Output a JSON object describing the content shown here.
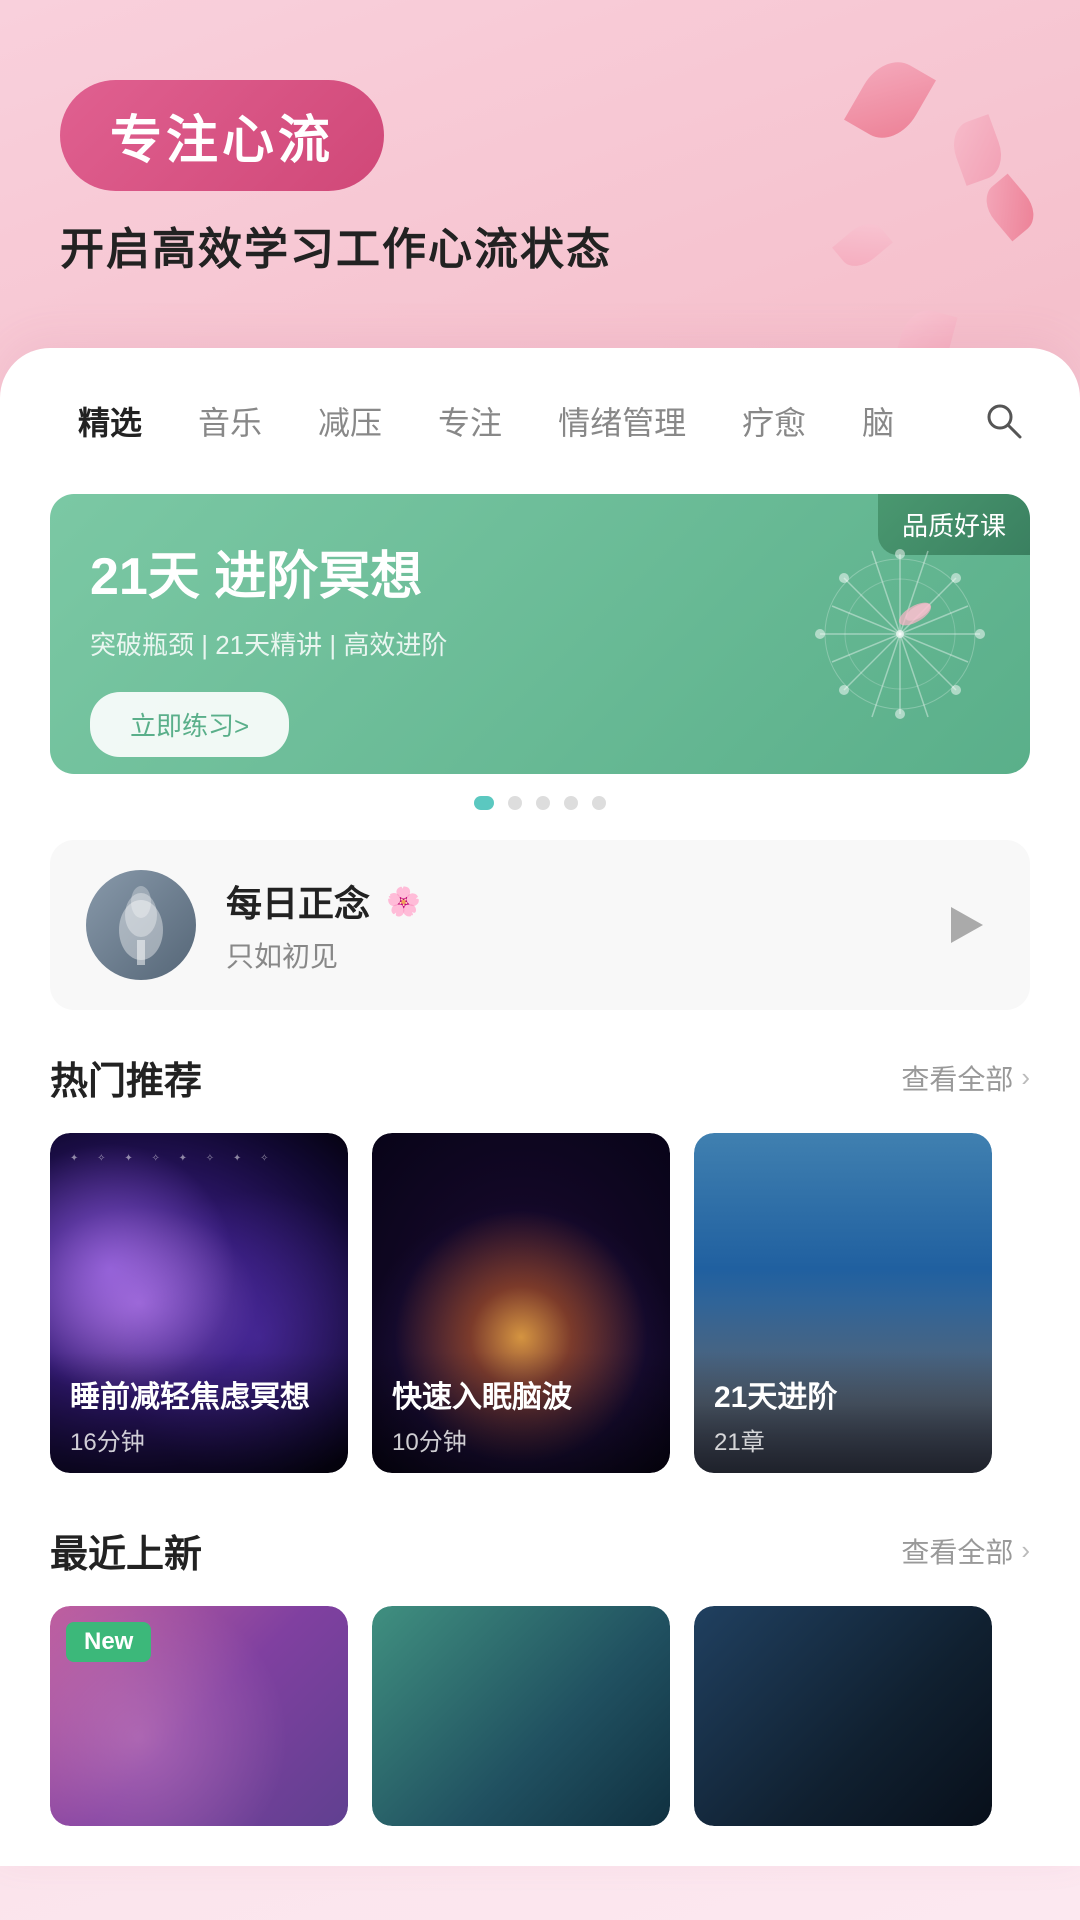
{
  "hero": {
    "badge": "专注心流",
    "subtitle": "开启高效学习工作心流状态"
  },
  "nav": {
    "tabs": [
      {
        "label": "精选",
        "active": true
      },
      {
        "label": "音乐",
        "active": false
      },
      {
        "label": "减压",
        "active": false
      },
      {
        "label": "专注",
        "active": false
      },
      {
        "label": "情绪管理",
        "active": false
      },
      {
        "label": "疗愈",
        "active": false
      },
      {
        "label": "脑",
        "active": false
      }
    ],
    "search_label": "搜索"
  },
  "banner": {
    "badge": "品质好课",
    "title": "21天 进阶冥想",
    "desc": "突破瓶颈 | 21天精讲 | 高效进阶",
    "btn": "立即练习>",
    "dots": 5
  },
  "daily": {
    "title": "每日正念",
    "subtitle": "只如初见",
    "petal": "🌸"
  },
  "hot": {
    "section_title": "热门推荐",
    "view_all": "查看全部",
    "cards": [
      {
        "name": "睡前减轻焦虑冥想",
        "duration": "16分钟"
      },
      {
        "name": "快速入眠脑波",
        "duration": "10分钟"
      },
      {
        "name": "21天进阶",
        "duration": "21章"
      }
    ]
  },
  "recent": {
    "section_title": "最近上新",
    "view_all": "查看全部",
    "cards": [
      {
        "name": "",
        "has_new": true
      },
      {
        "name": "",
        "has_new": false
      },
      {
        "name": "",
        "has_new": false
      }
    ],
    "new_badge": "New"
  }
}
